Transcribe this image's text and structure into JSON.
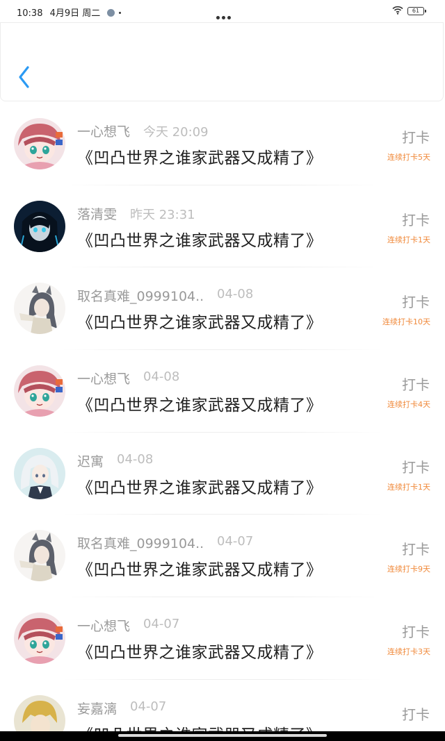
{
  "status_bar": {
    "time": "10:38",
    "date": "4月9日 周二",
    "battery": "61",
    "icons": [
      "app-notification-icon",
      "more-dots-icon",
      "wifi-icon",
      "battery-icon"
    ]
  },
  "header": {
    "back_icon": "chevron-left-icon",
    "accent_color": "#2b9af3"
  },
  "checkin_list": [
    {
      "user": "一心想飞",
      "time": "今天 20:09",
      "book": "《凹凸世界之谁家武器又成精了》",
      "action": "打卡",
      "streak": "连续打卡5天",
      "avatar": "pink-hair-girl"
    },
    {
      "user": "落清雯",
      "time": "昨天 23:31",
      "book": "《凹凸世界之谁家武器又成精了》",
      "action": "打卡",
      "streak": "连续打卡1天",
      "avatar": "dark-hair-character"
    },
    {
      "user": "取名真难_0999104..",
      "time": "04-08",
      "book": "《凹凸世界之谁家武器又成精了》",
      "action": "打卡",
      "streak": "连续打卡10天",
      "avatar": "cat-ear-character"
    },
    {
      "user": "一心想飞",
      "time": "04-08",
      "book": "《凹凸世界之谁家武器又成精了》",
      "action": "打卡",
      "streak": "连续打卡4天",
      "avatar": "pink-hair-girl"
    },
    {
      "user": "迟寓",
      "time": "04-08",
      "book": "《凹凸世界之谁家武器又成精了》",
      "action": "打卡",
      "streak": "连续打卡1天",
      "avatar": "white-hair-character"
    },
    {
      "user": "取名真难_0999104..",
      "time": "04-07",
      "book": "《凹凸世界之谁家武器又成精了》",
      "action": "打卡",
      "streak": "连续打卡9天",
      "avatar": "cat-ear-character"
    },
    {
      "user": "一心想飞",
      "time": "04-07",
      "book": "《凹凸世界之谁家武器又成精了》",
      "action": "打卡",
      "streak": "连续打卡3天",
      "avatar": "pink-hair-girl"
    },
    {
      "user": "妄嘉漓",
      "time": "04-07",
      "book": "《凹凸世界之谁家武器又成精了》",
      "action": "打卡",
      "streak": "",
      "avatar": "blonde-character"
    }
  ],
  "colors": {
    "streak": "#f0893a",
    "username": "#9a9a9a",
    "time": "#bdbdbd",
    "title": "#1f1f1f"
  }
}
